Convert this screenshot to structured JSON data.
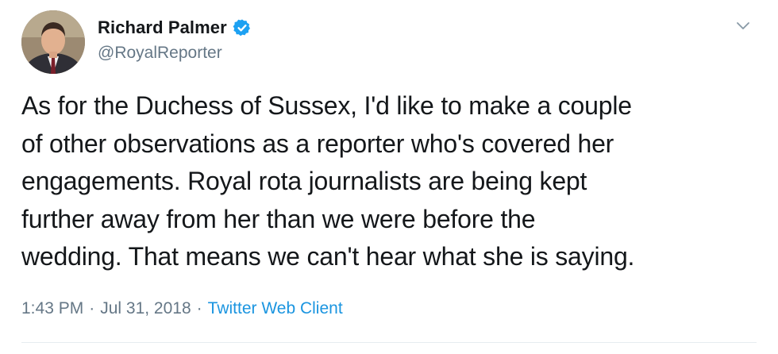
{
  "author": {
    "display_name": "Richard Palmer",
    "handle": "@RoyalReporter",
    "verified": true,
    "avatar_icon": "profile-photo"
  },
  "tweet": {
    "text_lines": [
      "As for the Duchess of Sussex, I'd like to make a couple",
      "of other observations as a reporter who's covered her",
      "engagements. Royal rota journalists are being kept",
      "further away from her than we were before the",
      "wedding. That means we can't hear what she is saying."
    ],
    "time": "1:43 PM",
    "date": "Jul 31, 2018",
    "separator": "·",
    "source": "Twitter Web Client"
  },
  "icons": {
    "verified": "verified-badge-icon",
    "menu": "chevron-down-icon"
  },
  "colors": {
    "text": "#14171a",
    "secondary": "#657786",
    "link": "#1b95e0",
    "verified": "#1da1f2"
  }
}
